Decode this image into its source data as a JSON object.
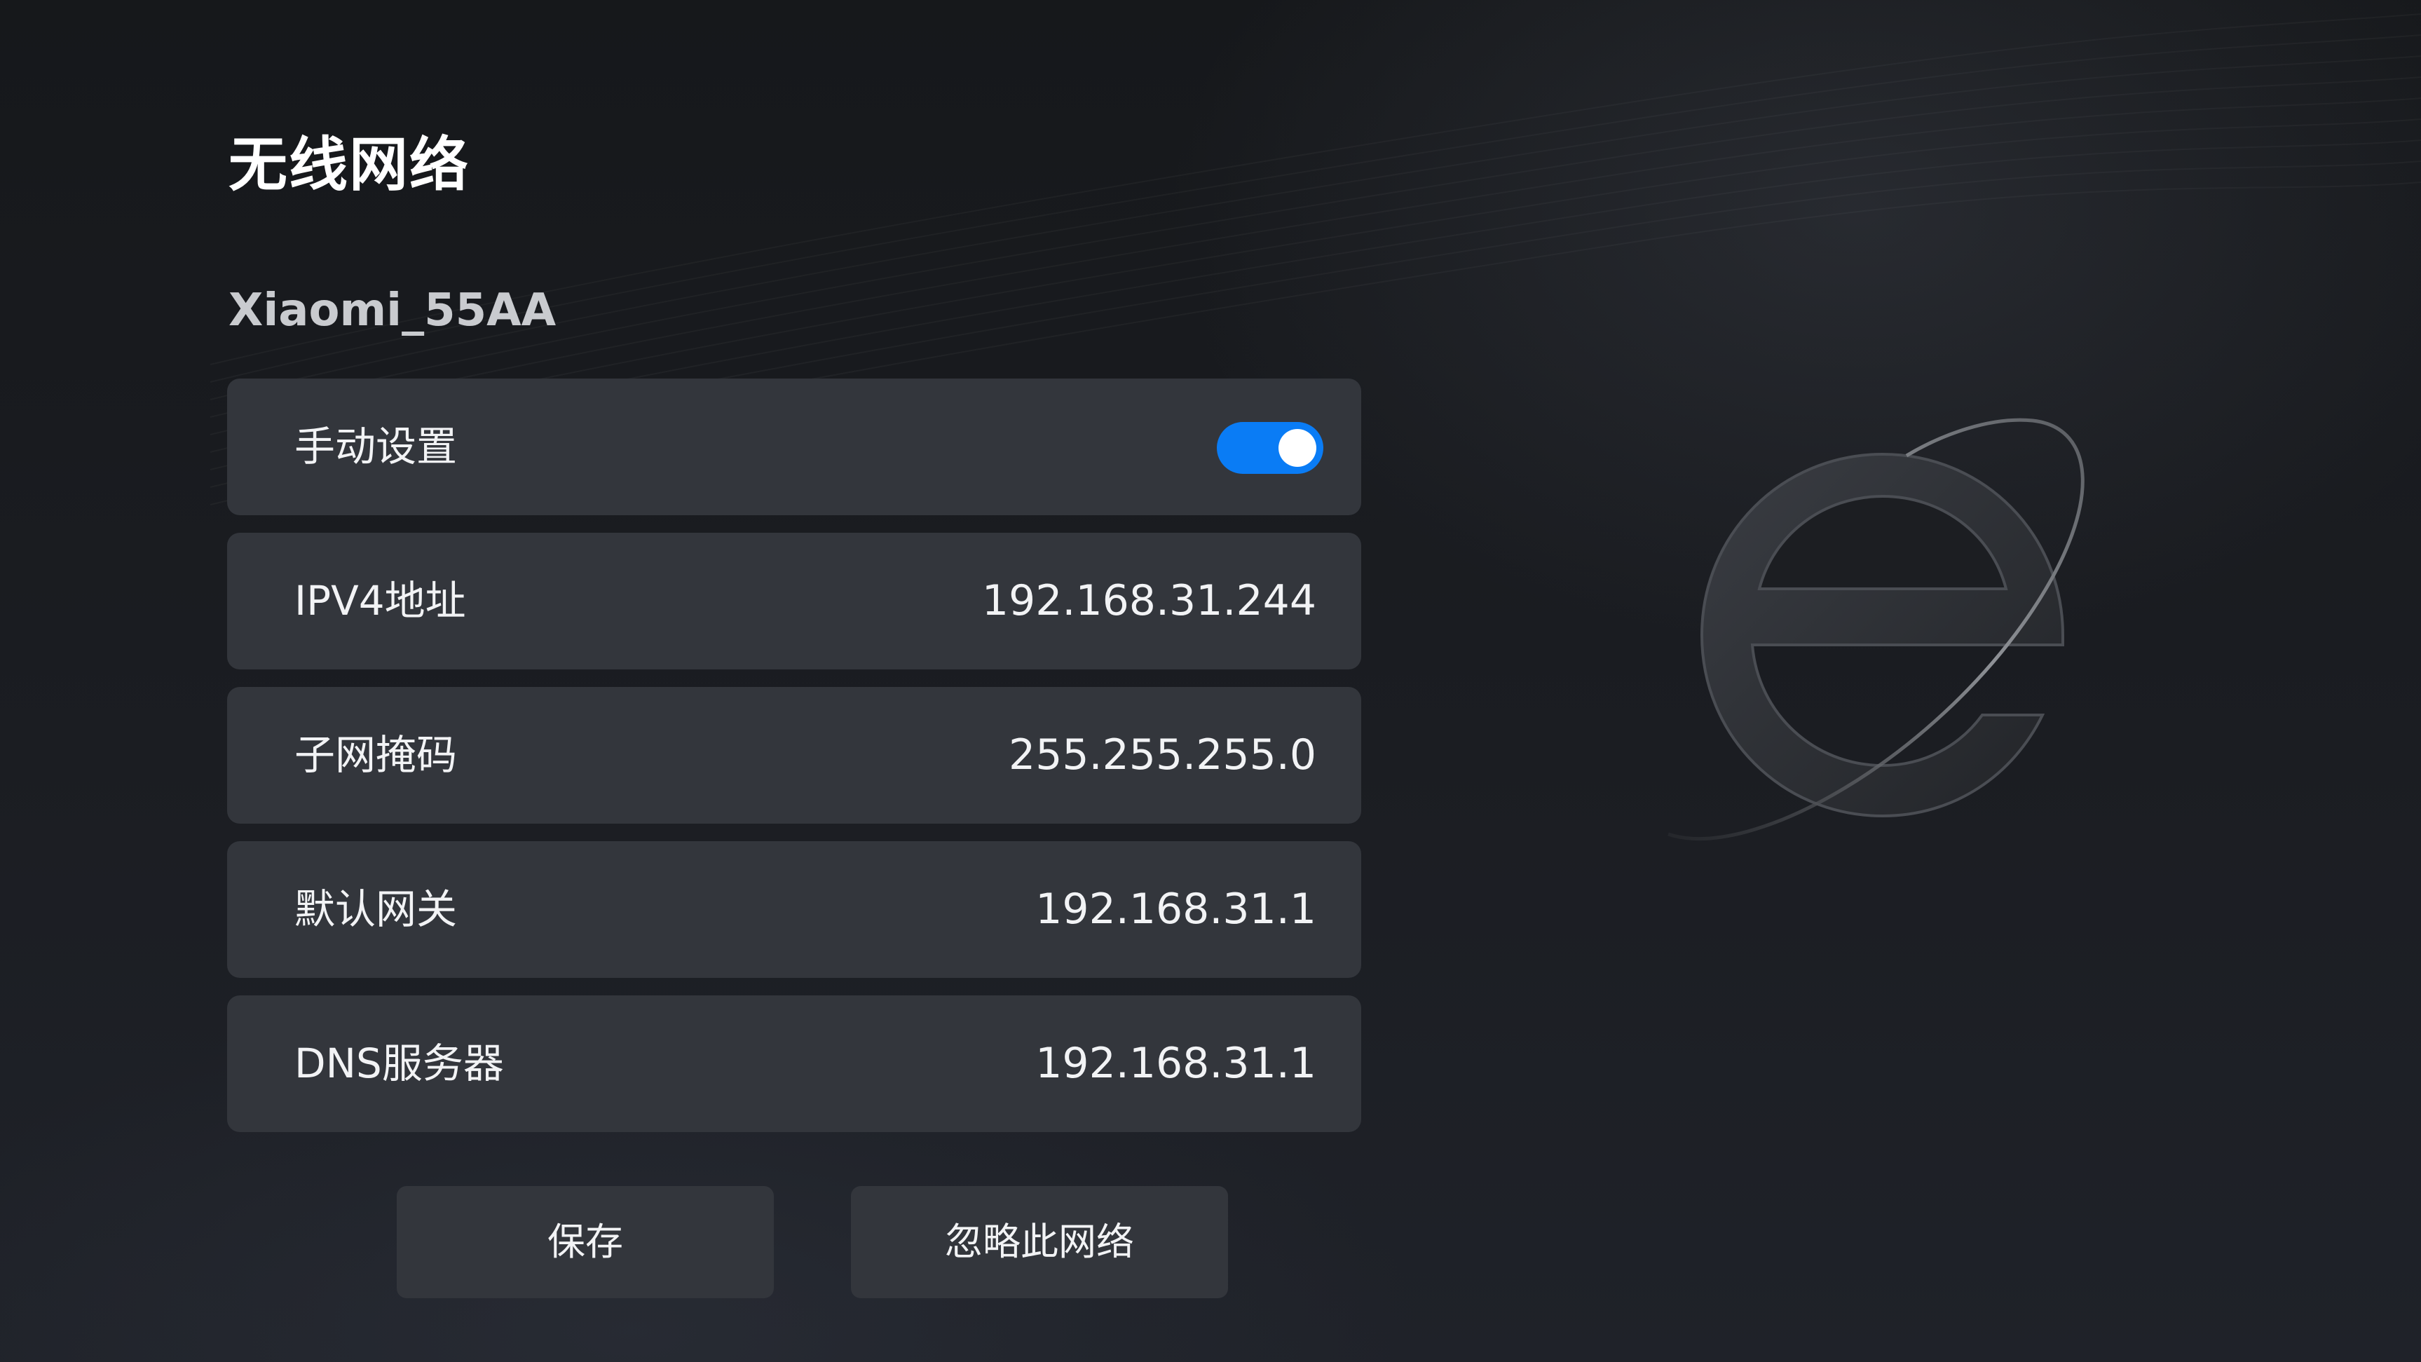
{
  "page": {
    "title": "无线网络",
    "network_name": "Xiaomi_55AA"
  },
  "settings": {
    "manual": {
      "label": "手动设置",
      "enabled": true
    },
    "rows": [
      {
        "label": "IPV4地址",
        "value": "192.168.31.244"
      },
      {
        "label": "子网掩码",
        "value": "255.255.255.0"
      },
      {
        "label": "默认网关",
        "value": "192.168.31.1"
      },
      {
        "label": "DNS服务器",
        "value": "192.168.31.1"
      }
    ]
  },
  "actions": {
    "save_label": "保存",
    "forget_label": "忽略此网络"
  },
  "colors": {
    "background": "#1a1c20",
    "row_background": "#33363c",
    "toggle_on": "#0a7cf5",
    "text_primary": "#ffffff",
    "text_secondary": "#c9cbcf"
  },
  "icons": {
    "brand_logo": "browser-e-logo-icon",
    "toggle": "toggle-switch-on"
  }
}
